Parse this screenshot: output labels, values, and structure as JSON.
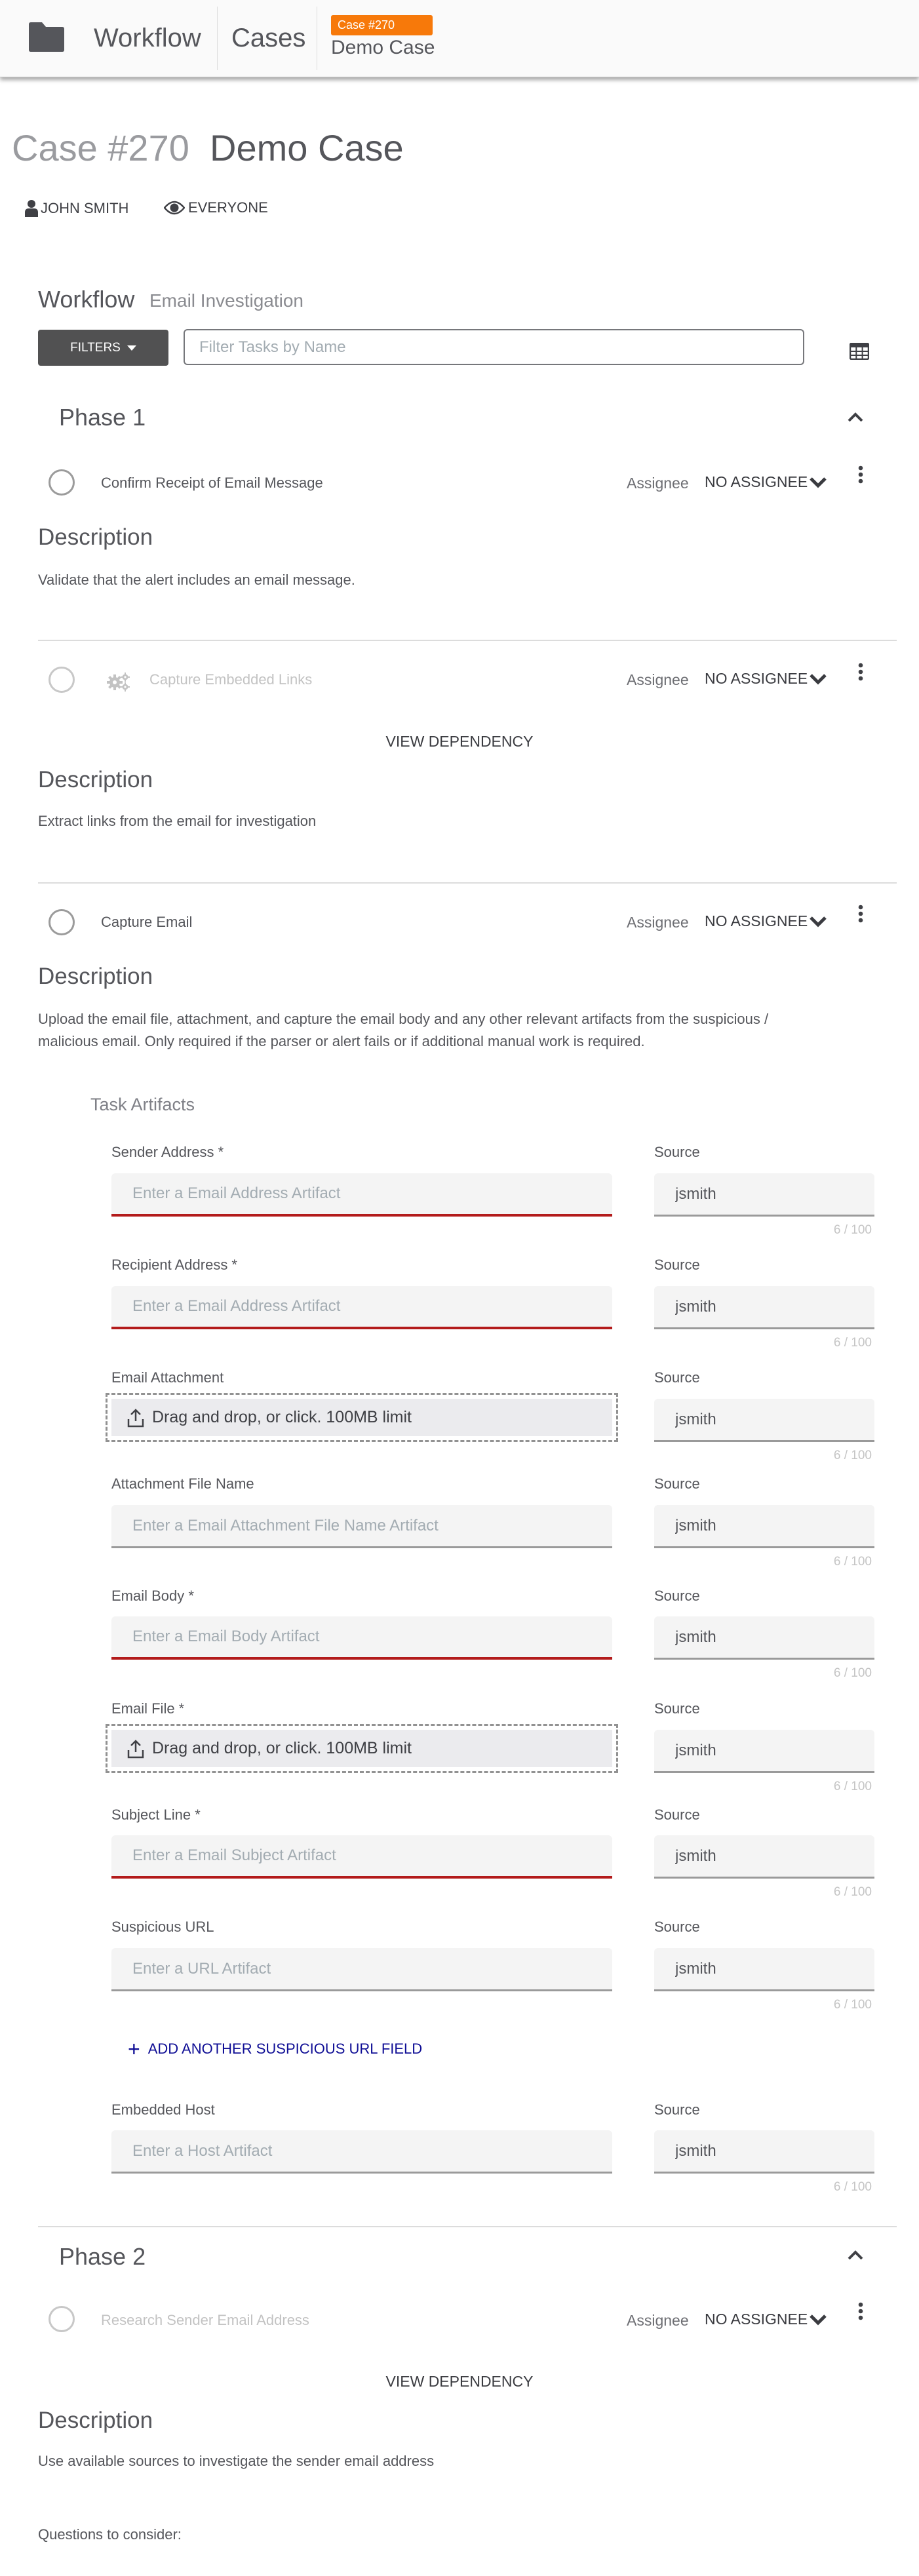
{
  "header": {
    "folder_icon": "folder-icon",
    "nav_workflow": "Workflow",
    "nav_cases": "Cases",
    "case_badge": "Case #270",
    "case_name": "Demo Case",
    "badge_color": "#f7790a"
  },
  "case": {
    "number_label": "Case #270",
    "name": "Demo Case",
    "owner": "JOHN SMITH",
    "visibility": "EVERYONE",
    "owner_icon": "user-icon",
    "visibility_icon": "eye-icon"
  },
  "workflow": {
    "title": "Workflow",
    "name": "Email Investigation",
    "filters_label": "FILTERS",
    "filter_placeholder": "Filter Tasks by Name",
    "grid_icon": "table-grid-icon"
  },
  "phases": [
    {
      "title": "Phase 1",
      "tasks": [
        {
          "name": "Confirm Receipt of Email Message",
          "assignee_label": "Assignee",
          "assignee": "NO ASSIGNEE",
          "description_heading": "Description",
          "description": "Validate that the alert includes an email message."
        },
        {
          "name": "Capture Embedded Links",
          "automated_icon": "gears-icon",
          "assignee_label": "Assignee",
          "assignee": "NO ASSIGNEE",
          "view_dependency": "VIEW DEPENDENCY",
          "description_heading": "Description",
          "description": "Extract links from the email for investigation"
        },
        {
          "name": "Capture Email",
          "assignee_label": "Assignee",
          "assignee": "NO ASSIGNEE",
          "description_heading": "Description",
          "description_line1": "Upload the email file, attachment, and capture the email body and any other relevant artifacts from the suspicious /",
          "description_line2": "malicious email. Only required if the parser or alert fails or if additional manual work is required.",
          "artifacts": {
            "title": "Task Artifacts",
            "source_label": "Source",
            "source_value": "jsmith",
            "counter": "6 / 100",
            "dropzone_text": "Drag and drop, or click. 100MB limit",
            "fields": [
              {
                "label": "Sender Address *",
                "placeholder": "Enter a Email Address Artifact",
                "required": true
              },
              {
                "label": "Recipient Address *",
                "placeholder": "Enter a Email Address Artifact",
                "required": true
              },
              {
                "label": "Email Attachment",
                "type": "file"
              },
              {
                "label": "Attachment File Name",
                "placeholder": "Enter a Email Attachment File Name Artifact",
                "required": false
              },
              {
                "label": "Email Body *",
                "placeholder": "Enter a Email Body Artifact",
                "required": true
              },
              {
                "label": "Email File *",
                "type": "file"
              },
              {
                "label": "Subject Line *",
                "placeholder": "Enter a Email Subject Artifact",
                "required": true
              },
              {
                "label": "Suspicious URL",
                "placeholder": "Enter a URL Artifact",
                "required": false
              },
              {
                "label": "Embedded Host",
                "placeholder": "Enter a Host Artifact",
                "required": false
              }
            ],
            "add_another_label": "ADD ANOTHER SUSPICIOUS URL FIELD",
            "error_color": "#b31b1b",
            "link_color": "#0f0e95"
          }
        }
      ]
    },
    {
      "title": "Phase 2",
      "tasks": [
        {
          "name": "Research Sender Email Address",
          "assignee_label": "Assignee",
          "assignee": "NO ASSIGNEE",
          "view_dependency": "VIEW DEPENDENCY",
          "description_heading": "Description",
          "description": "Use available sources to investigate the sender email address",
          "questions_heading": "Questions to consider:"
        }
      ]
    }
  ]
}
